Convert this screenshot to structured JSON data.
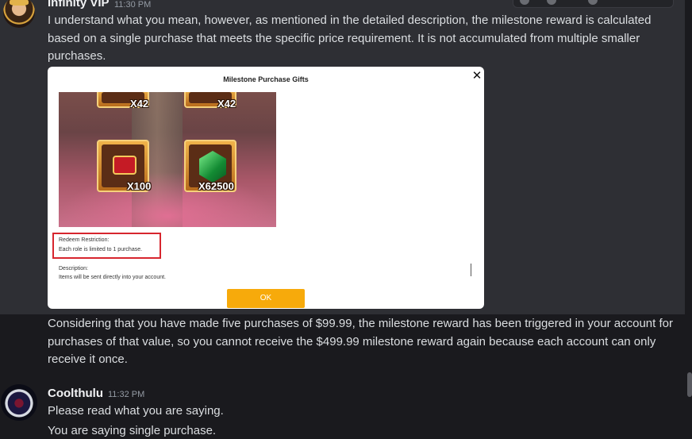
{
  "messages": [
    {
      "author": "Infinity VIP",
      "time": "11:30 PM",
      "text": "I understand what you mean, however, as mentioned in the detailed description, the milestone reward is calculated based on a single purchase that meets the specific price requirement. It is not accumulated from multiple smaller purchases.",
      "avatar_icon": "character-avatar-icon",
      "attachment": {
        "title": "Milestone Purchase Gifts",
        "close_glyph": "✕",
        "rewards": [
          {
            "icon": "reward-tile-icon",
            "qty": "X42"
          },
          {
            "icon": "reward-tile-icon",
            "qty": "X42"
          },
          {
            "icon": "treasure-chest-icon",
            "qty": "X100"
          },
          {
            "icon": "green-gem-icon",
            "qty": "X62500"
          }
        ],
        "restriction_label": "Redeem Restriction:",
        "restriction_text": "Each role is limited to 1 purchase.",
        "description_label": "Description:",
        "description_text": "Items will be sent directly into your account.",
        "ok_label": "OK"
      },
      "followup": "Considering that you have made five purchases of $99.99, the milestone reward has been triggered in your account for purchases of that value, so you cannot receive the $499.99 milestone reward again because each account can only receive it once."
    },
    {
      "author": "Coolthulu",
      "time": "11:32 PM",
      "avatar_icon": "helmet-avatar-icon",
      "lines": [
        "Please read what you are saying.",
        "You are saying single purchase."
      ]
    }
  ],
  "colors": {
    "background": "#1a1a1e",
    "hover_background": "#2e2f34",
    "ok_button": "#f7aa0b",
    "highlight_box": "#d7262e"
  }
}
